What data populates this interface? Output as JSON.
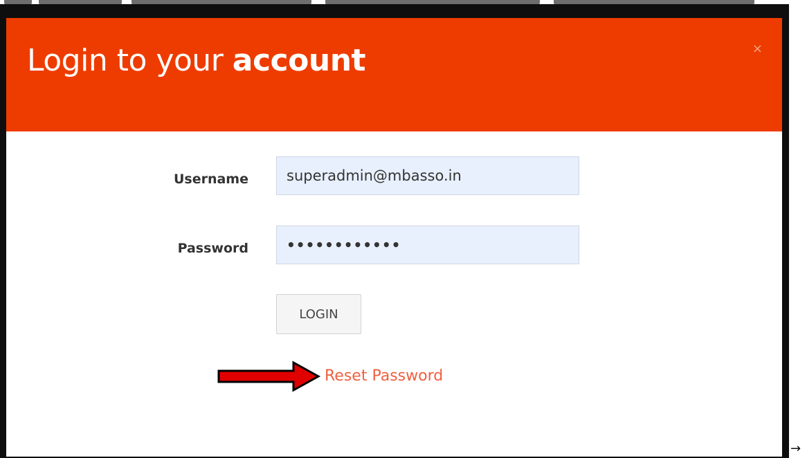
{
  "modal": {
    "title_prefix": "Login to your ",
    "title_bold": "account",
    "close_symbol": "×"
  },
  "form": {
    "username_label": "Username",
    "username_value": "superadmin@mbasso.in",
    "password_label": "Password",
    "password_value": "••••••••••••",
    "login_label": "LOGIN"
  },
  "reset_link": "Reset Password",
  "trailing_symbol": "→",
  "icons": {
    "close": "close-icon",
    "annotation_arrow": "red-arrow-icon"
  },
  "colors": {
    "header": "#ee3c00",
    "link": "#f0603f",
    "input_bg": "#e8f0fe",
    "annotation_arrow": "#e00000"
  }
}
